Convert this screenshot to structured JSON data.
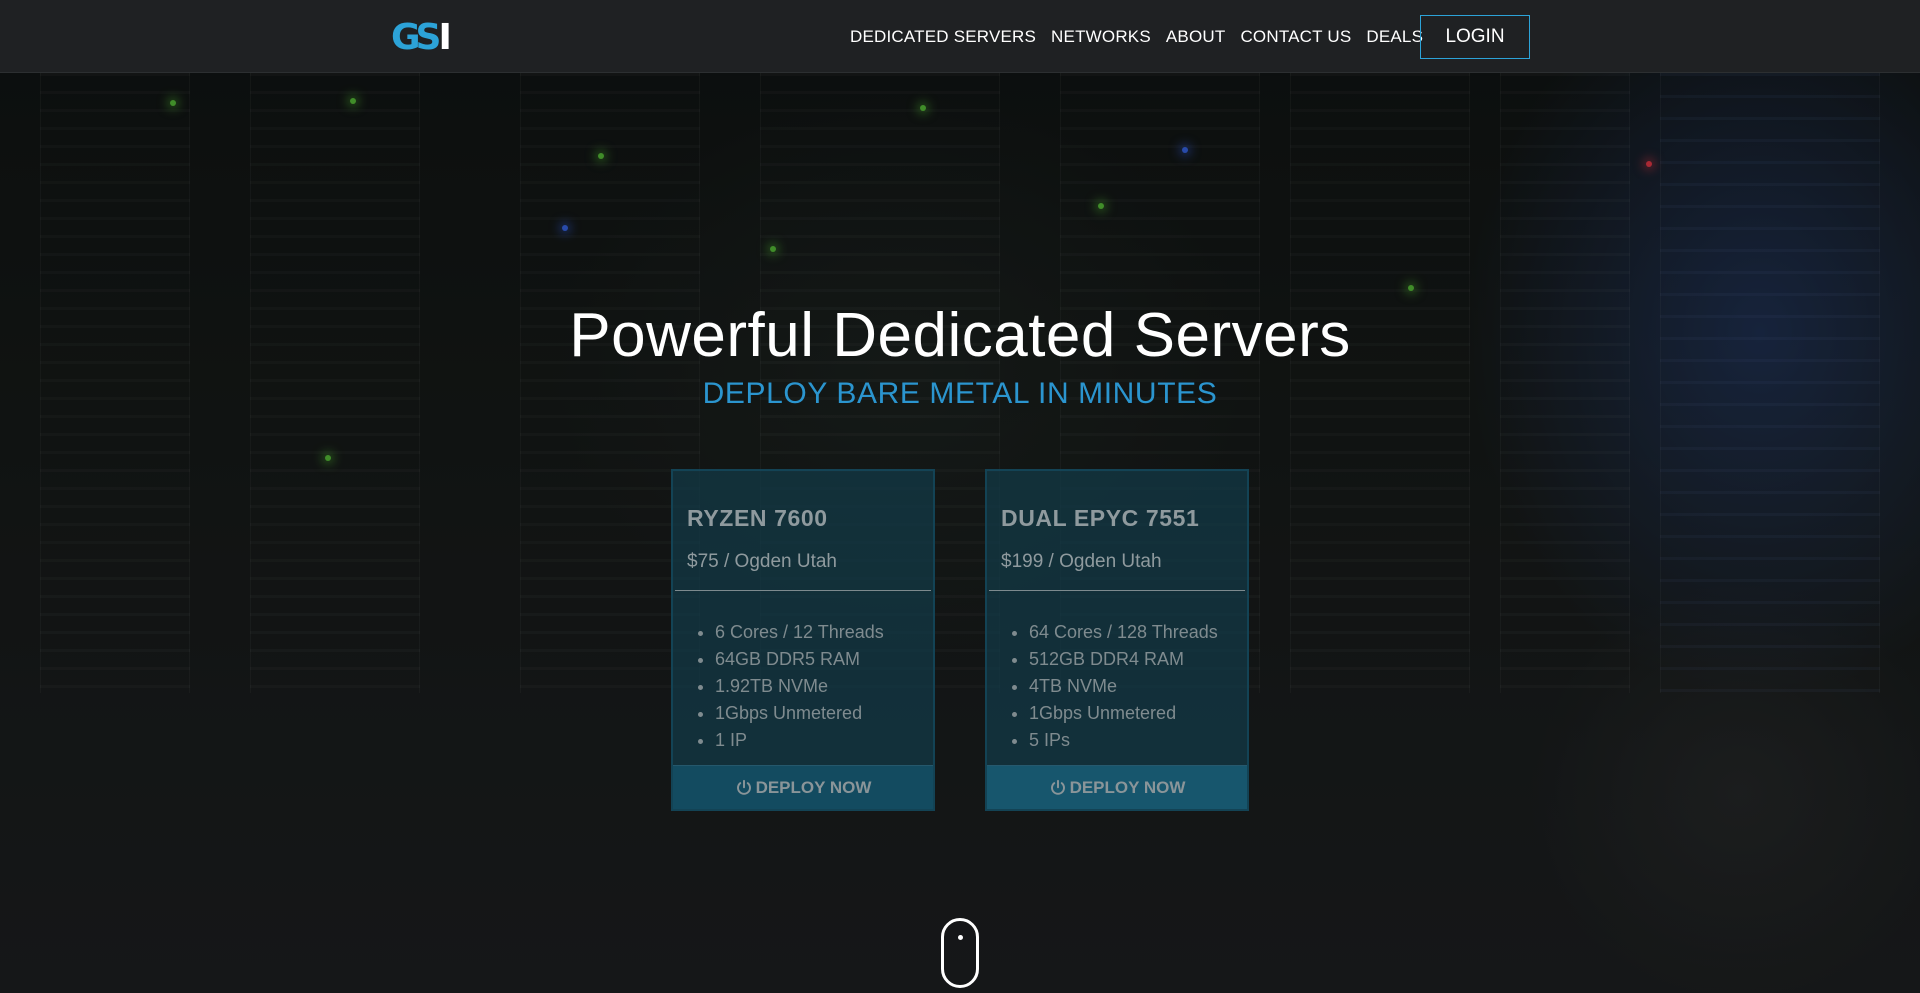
{
  "header": {
    "logo": {
      "gs": "GS",
      "i": "I"
    },
    "nav": [
      "DEDICATED SERVERS",
      "NETWORKS",
      "ABOUT",
      "CONTACT US",
      "DEALS"
    ],
    "login_label": "LOGIN"
  },
  "hero": {
    "title": "Powerful Dedicated Servers",
    "subtitle": "DEPLOY BARE METAL IN MINUTES"
  },
  "plans": [
    {
      "name": "RYZEN 7600",
      "price": "$75 / Ogden Utah",
      "specs": [
        "6 Cores / 12 Threads",
        "64GB DDR5 RAM",
        "1.92TB NVMe",
        "1Gbps Unmetered",
        "1 IP"
      ],
      "cta": "DEPLOY NOW"
    },
    {
      "name": "DUAL EPYC 7551",
      "price": "$199 / Ogden Utah",
      "specs": [
        "64 Cores / 128 Threads",
        "512GB DDR4 RAM",
        "4TB NVMe",
        "1Gbps Unmetered",
        "5 IPs"
      ],
      "cta": "DEPLOY NOW"
    }
  ],
  "colors": {
    "accent": "#2ca3d8",
    "subtitle": "#2b95cf",
    "header_bg": "#1f2123",
    "card_bg": "#123a48"
  },
  "icons": [
    "power-icon",
    "scroll-mouse-icon"
  ]
}
